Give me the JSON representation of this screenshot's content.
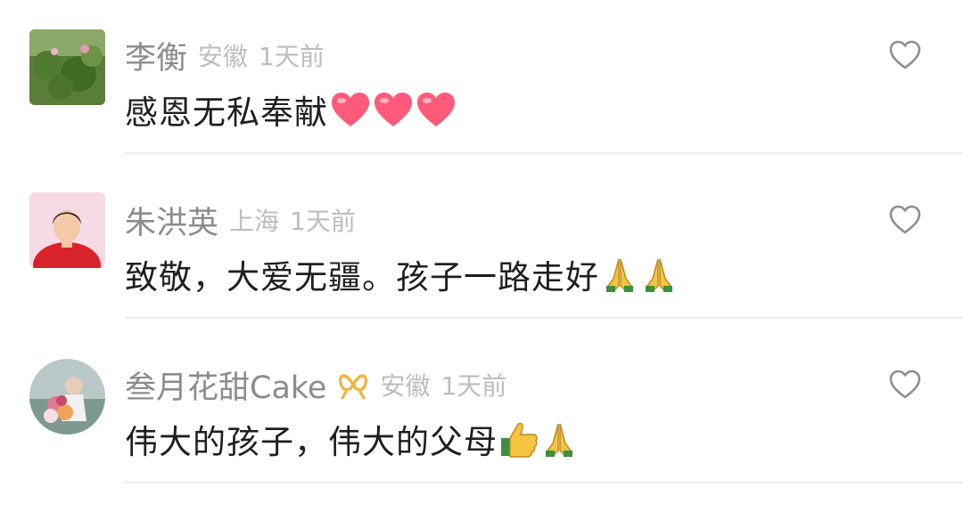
{
  "colors": {
    "name": "#8c8c8c",
    "meta": "#bdbdbd",
    "text": "#1f1f1f",
    "divider": "#ececec",
    "heart_emoji": "#ff5a7a",
    "badge": "#f2b33d"
  },
  "comments": [
    {
      "author": "李衡",
      "location": "安徽",
      "time": "1天前",
      "text": "感恩无私奉献",
      "emojis": [
        "heart-emoji",
        "heart-emoji",
        "heart-emoji"
      ],
      "avatar": "lotus-pond-photo",
      "like_icon": "heart-outline-icon"
    },
    {
      "author": "朱洪英",
      "location": "上海",
      "time": "1天前",
      "text": "致敬，大爱无疆。孩子一路走好",
      "emojis": [
        "pray-emoji",
        "pray-emoji"
      ],
      "avatar": "woman-portrait-photo",
      "like_icon": "heart-outline-icon"
    },
    {
      "author": "叁月花甜Cake",
      "location": "安徽",
      "time": "1天前",
      "text": "伟大的孩子，伟大的父母",
      "emojis": [
        "thumbs-up-emoji",
        "pray-emoji"
      ],
      "avatar": "bouquet-photo",
      "badge": "ribbon-badge-icon",
      "like_icon": "heart-outline-icon"
    }
  ]
}
